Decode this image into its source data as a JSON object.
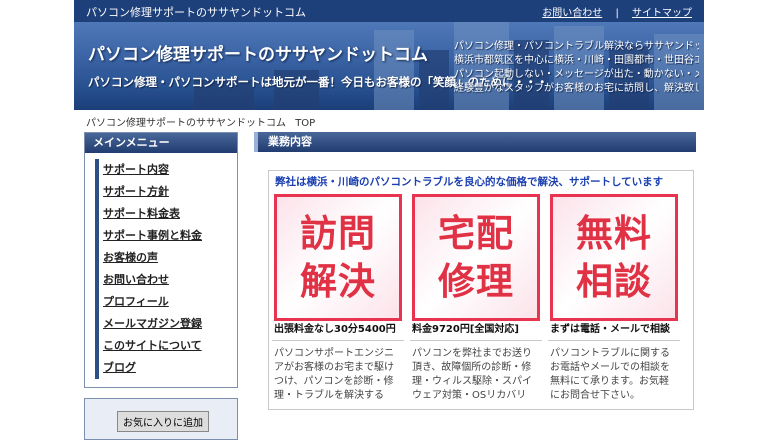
{
  "topbar": {
    "site_name": "パソコン修理サポートのササヤンドットコム",
    "contact_link": "お問い合わせ",
    "separator": "|",
    "sitemap_link": "サイトマップ"
  },
  "banner": {
    "title": "パソコン修理サポートのササヤンドットコム",
    "lead": "パソコン修理・パソコンサポートは地元が一番！今日もお客様の「笑顔」のために・・・",
    "desc": [
      "パソコン修理・パソコントラブル解決ならササヤンドットコム",
      "横浜市都筑区を中心に横浜・川崎・田園都市・世田谷エリア対応",
      "パソコン起動しない・メッセージが出た・動かない・メールが出来ない他",
      "経験豊かなスタッフがお客様のお宅に訪問し、解決致します"
    ]
  },
  "breadcrumb": {
    "site": "パソコン修理サポートのササヤンドットコム",
    "current": "TOP"
  },
  "sidebar": {
    "menu_title": "メインメニュー",
    "items": [
      {
        "label": "サポート内容"
      },
      {
        "label": "サポート方針"
      },
      {
        "label": "サポート料金表"
      },
      {
        "label": "サポート事例と料金"
      },
      {
        "label": "お客様の声"
      },
      {
        "label": "お問い合わせ"
      },
      {
        "label": "プロフィール"
      },
      {
        "label": "メールマガジン登録"
      },
      {
        "label": "このサイトについて"
      },
      {
        "label": "ブログ"
      }
    ],
    "favorite_button": "お気に入りに追加"
  },
  "main": {
    "section_title": "業務内容",
    "intro": "弊社は横浜・川崎のパソコントラブルを良心的な価格で解決、サポートしています",
    "services": [
      {
        "tile_line1": "訪問",
        "tile_line2": "解決",
        "caption": "出張料金なし30分5400円",
        "text": "パソコンサポートエンジニアがお客様のお宅まで駆けつけ、パソコンを診断・修理・トラブルを解決する"
      },
      {
        "tile_line1": "宅配",
        "tile_line2": "修理",
        "caption": "料金9720円[全国対応]",
        "text": "パソコンを弊社までお送り頂き、故障個所の診断・修理・ウィルス駆除・スパイウェア対策・OSリカバリ"
      },
      {
        "tile_line1": "無料",
        "tile_line2": "相談",
        "caption": "まずは電話・メールで相談",
        "text": "パソコントラブルに関するお電話やメールでの相談を無料にて承ります。お気軽にお問合せ下さい。"
      }
    ]
  },
  "colors": {
    "navy": "#1d3f7a",
    "tile_red": "#e13145",
    "intro_blue": "#1a3fb0"
  }
}
